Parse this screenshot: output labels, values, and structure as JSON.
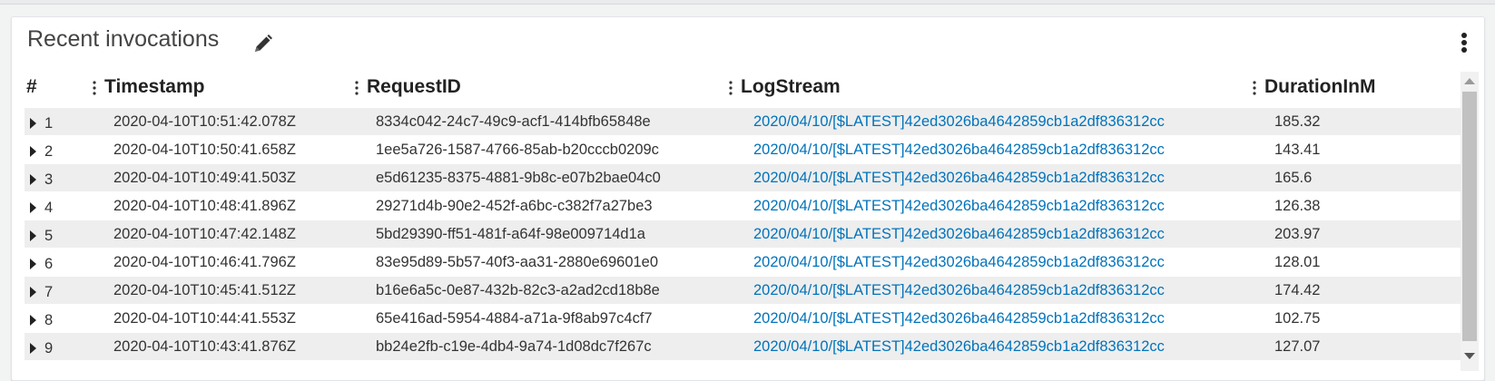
{
  "widget": {
    "title": "Recent invocations",
    "edit_icon": "pencil-icon",
    "menu_icon": "vertical-ellipsis-icon"
  },
  "table": {
    "columns": [
      "#",
      "Timestamp",
      "RequestID",
      "LogStream",
      "DurationInM"
    ],
    "rows": [
      {
        "n": "1",
        "timestamp": "2020-04-10T10:51:42.078Z",
        "request_id": "8334c042-24c7-49c9-acf1-414bfb65848e",
        "log_stream": "2020/04/10/[$LATEST]42ed3026ba4642859cb1a2df836312cc",
        "duration": "185.32"
      },
      {
        "n": "2",
        "timestamp": "2020-04-10T10:50:41.658Z",
        "request_id": "1ee5a726-1587-4766-85ab-b20cccb0209c",
        "log_stream": "2020/04/10/[$LATEST]42ed3026ba4642859cb1a2df836312cc",
        "duration": "143.41"
      },
      {
        "n": "3",
        "timestamp": "2020-04-10T10:49:41.503Z",
        "request_id": "e5d61235-8375-4881-9b8c-e07b2bae04c0",
        "log_stream": "2020/04/10/[$LATEST]42ed3026ba4642859cb1a2df836312cc",
        "duration": "165.6"
      },
      {
        "n": "4",
        "timestamp": "2020-04-10T10:48:41.896Z",
        "request_id": "29271d4b-90e2-452f-a6bc-c382f7a27be3",
        "log_stream": "2020/04/10/[$LATEST]42ed3026ba4642859cb1a2df836312cc",
        "duration": "126.38"
      },
      {
        "n": "5",
        "timestamp": "2020-04-10T10:47:42.148Z",
        "request_id": "5bd29390-ff51-481f-a64f-98e009714d1a",
        "log_stream": "2020/04/10/[$LATEST]42ed3026ba4642859cb1a2df836312cc",
        "duration": "203.97"
      },
      {
        "n": "6",
        "timestamp": "2020-04-10T10:46:41.796Z",
        "request_id": "83e95d89-5b57-40f3-aa31-2880e69601e0",
        "log_stream": "2020/04/10/[$LATEST]42ed3026ba4642859cb1a2df836312cc",
        "duration": "128.01"
      },
      {
        "n": "7",
        "timestamp": "2020-04-10T10:45:41.512Z",
        "request_id": "b16e6a5c-0e87-432b-82c3-a2ad2cd18b8e",
        "log_stream": "2020/04/10/[$LATEST]42ed3026ba4642859cb1a2df836312cc",
        "duration": "174.42"
      },
      {
        "n": "8",
        "timestamp": "2020-04-10T10:44:41.553Z",
        "request_id": "65e416ad-5954-4884-a71a-9f8ab97c4cf7",
        "log_stream": "2020/04/10/[$LATEST]42ed3026ba4642859cb1a2df836312cc",
        "duration": "102.75"
      },
      {
        "n": "9",
        "timestamp": "2020-04-10T10:43:41.876Z",
        "request_id": "bb24e2fb-c19e-4db4-9a74-1d08dc7f267c",
        "log_stream": "2020/04/10/[$LATEST]42ed3026ba4642859cb1a2df836312cc",
        "duration": "127.07"
      }
    ]
  },
  "colors": {
    "link": "#0073bb",
    "stripe": "#eeeeee",
    "header_text": "#222222"
  }
}
